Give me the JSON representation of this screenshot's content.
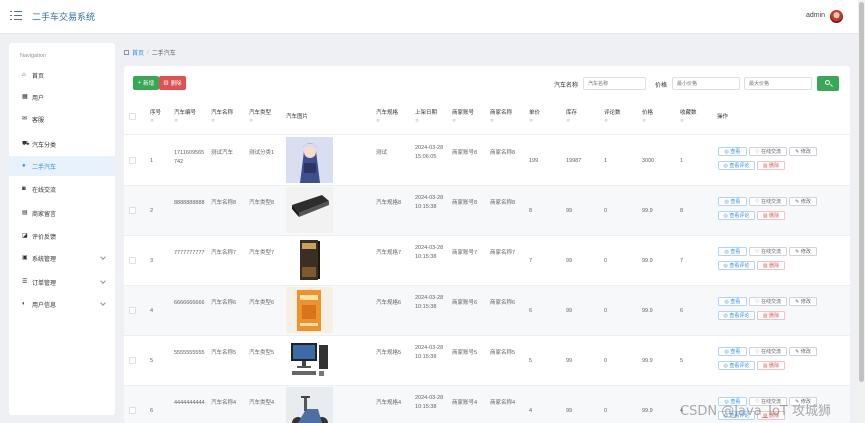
{
  "header": {
    "title": "二手车交易系统",
    "user": "admin"
  },
  "sidebar": {
    "heading": "Navigation",
    "items": [
      {
        "label": "首页",
        "icon": "home-icon"
      },
      {
        "label": "用户",
        "icon": "grid-icon"
      },
      {
        "label": "客服",
        "icon": "mail-icon"
      },
      {
        "label": "汽车分类",
        "icon": "car-icon"
      },
      {
        "label": "二手汽车",
        "icon": "user-icon",
        "active": true
      },
      {
        "label": "在线交流",
        "icon": "chat-icon"
      },
      {
        "label": "商家留言",
        "icon": "message-icon"
      },
      {
        "label": "评价反馈",
        "icon": "feedback-icon"
      },
      {
        "label": "系统管理",
        "icon": "settings-icon",
        "expandable": true
      },
      {
        "label": "订单管理",
        "icon": "order-icon",
        "expandable": true
      },
      {
        "label": "用户信息",
        "icon": "person-icon",
        "expandable": true
      }
    ]
  },
  "breadcrumb": {
    "home": "首页",
    "sep": "/",
    "current": "二手汽车"
  },
  "toolbar": {
    "add_label": "新增",
    "delete_label": "删除",
    "name_label": "汽车名称",
    "name_placeholder": "汽车名称",
    "price_label": "价格",
    "min_price_placeholder": "最小价格",
    "max_price_placeholder": "最大价格"
  },
  "table": {
    "columns": [
      "序号",
      "汽车编号",
      "汽车名称",
      "汽车类型",
      "汽车图片",
      "汽车规格",
      "上架日期",
      "商家账号",
      "商家名称",
      "单价",
      "库存",
      "评论数",
      "价格",
      "收藏数",
      "操作"
    ],
    "sort_glyph": "≑",
    "actions": {
      "view": "查看",
      "chat": "在线交流",
      "edit": "修改",
      "comments": "查看评论",
      "delete": "删除"
    },
    "rows": [
      {
        "index": "1",
        "code": "1711609565742",
        "name": "测试汽车",
        "type": "测试分类1",
        "image": "anime-figure",
        "spec": "测试",
        "date": "2024-03-28 15:06:05",
        "account": "商家账号8",
        "shop": "商家名称8",
        "unit_price": "199",
        "stock": "19987",
        "comments": "1",
        "price": "3000",
        "favorites": "1"
      },
      {
        "index": "2",
        "code": "8888888888",
        "name": "汽车名称8",
        "type": "汽车类型8",
        "image": "laptop",
        "spec": "汽车规格8",
        "date": "2024-03-28 10:15:38",
        "account": "商家账号8",
        "shop": "商家名称8",
        "unit_price": "8",
        "stock": "99",
        "comments": "0",
        "price": "99.9",
        "favorites": "8"
      },
      {
        "index": "3",
        "code": "7777777777",
        "name": "汽车名称7",
        "type": "汽车类型7",
        "image": "book-dark",
        "spec": "汽车规格7",
        "date": "2024-03-28 10:15:38",
        "account": "商家账号7",
        "shop": "商家名称7",
        "unit_price": "7",
        "stock": "99",
        "comments": "0",
        "price": "99.9",
        "favorites": "7"
      },
      {
        "index": "4",
        "code": "6666666666",
        "name": "汽车名称6",
        "type": "汽车类型6",
        "image": "book-orange",
        "spec": "汽车规格6",
        "date": "2024-03-28 10:15:38",
        "account": "商家账号6",
        "shop": "商家名称6",
        "unit_price": "6",
        "stock": "99",
        "comments": "0",
        "price": "99.9",
        "favorites": "6"
      },
      {
        "index": "5",
        "code": "5555555555",
        "name": "汽车名称5",
        "type": "汽车类型5",
        "image": "desktop",
        "spec": "汽车规格5",
        "date": "2024-03-28 10:15:38",
        "account": "商家账号5",
        "shop": "商家名称5",
        "unit_price": "5",
        "stock": "99",
        "comments": "0",
        "price": "99.9",
        "favorites": "5"
      },
      {
        "index": "6",
        "code": "4444444444",
        "name": "汽车名称4",
        "type": "汽车类型4",
        "image": "scooter",
        "spec": "汽车规格4",
        "date": "2024-03-28 10:15:38",
        "account": "商家账号4",
        "shop": "商家名称4",
        "unit_price": "4",
        "stock": "99",
        "comments": "0",
        "price": "99.9",
        "favorites": "4"
      }
    ]
  },
  "watermark": "CSDN @Java_IoT 攻城狮",
  "colors": {
    "primary": "#2d8cf0",
    "success": "#3aa757",
    "danger": "#e05252"
  }
}
